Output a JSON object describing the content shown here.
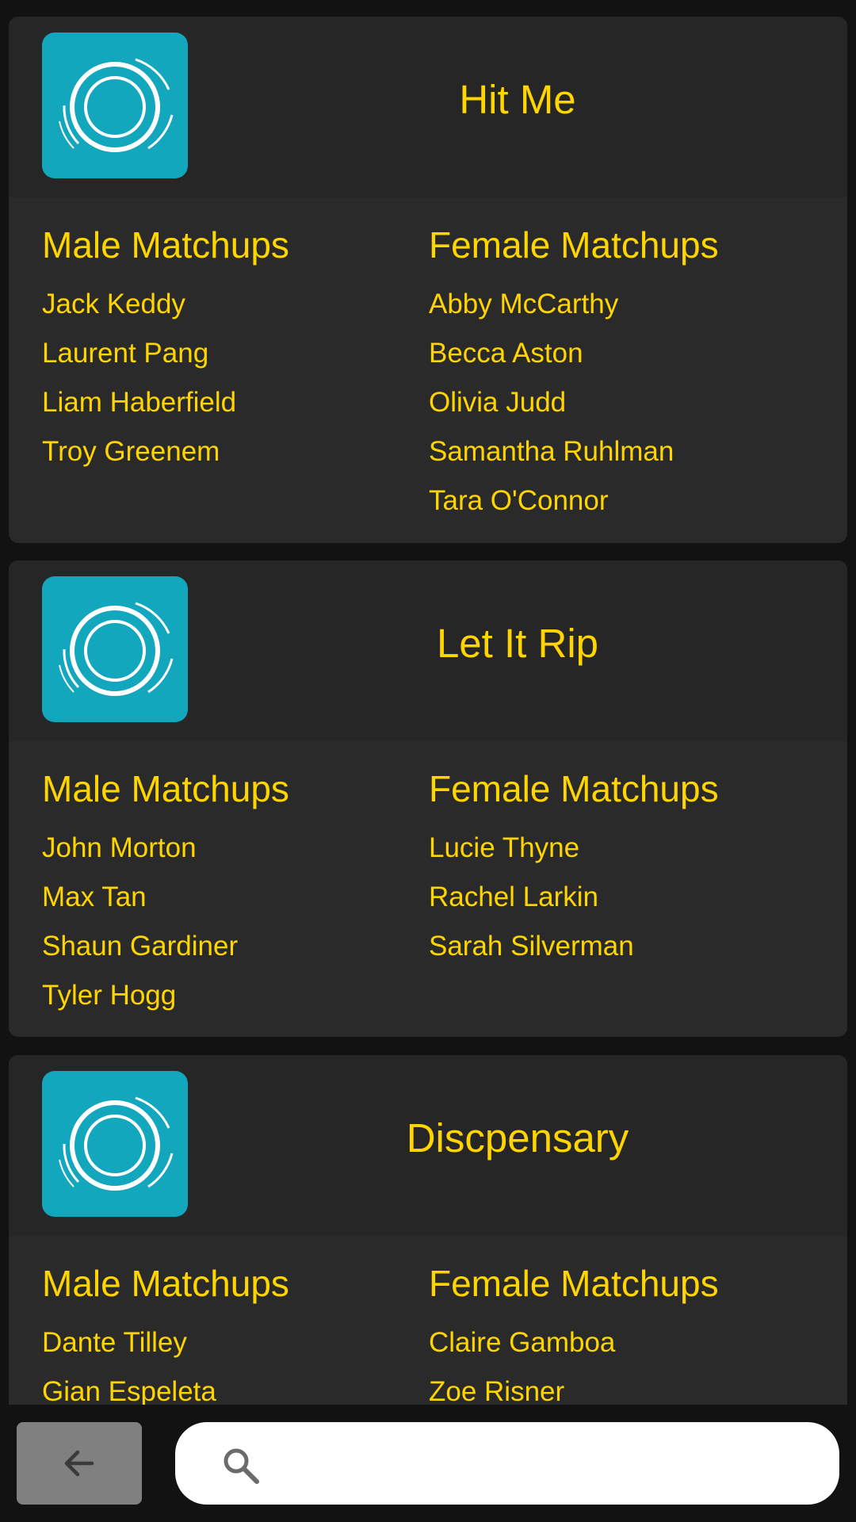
{
  "cards": [
    {
      "title": "Hit Me",
      "icon": "camera-lens-icon",
      "male_heading": "Male Matchups",
      "female_heading": "Female Matchups",
      "male": [
        "Jack Keddy",
        "Laurent Pang",
        "Liam Haberfield",
        "Troy Greenem"
      ],
      "female": [
        "Abby McCarthy",
        "Becca Aston",
        "Olivia Judd",
        "Samantha Ruhlman",
        "Tara O'Connor"
      ]
    },
    {
      "title": "Let It Rip",
      "icon": "camera-lens-icon",
      "male_heading": "Male Matchups",
      "female_heading": "Female Matchups",
      "male": [
        "John Morton",
        "Max Tan",
        "Shaun Gardiner",
        "Tyler Hogg"
      ],
      "female": [
        "Lucie Thyne",
        "Rachel Larkin",
        "Sarah Silverman"
      ]
    },
    {
      "title": "Discpensary",
      "icon": "camera-lens-icon",
      "male_heading": "Male Matchups",
      "female_heading": "Female Matchups",
      "male": [
        "Dante Tilley",
        "Gian Espeleta"
      ],
      "female": [
        "Claire Gamboa",
        "Zoe Risner"
      ]
    }
  ],
  "bottom_bar": {
    "back_icon": "arrow-left-icon",
    "search_icon": "search-icon",
    "search_value": ""
  },
  "colors": {
    "accent_text": "#ffd500",
    "icon_background": "#12a7bd",
    "card_background": "#2a2a2a",
    "page_background": "#121212"
  }
}
